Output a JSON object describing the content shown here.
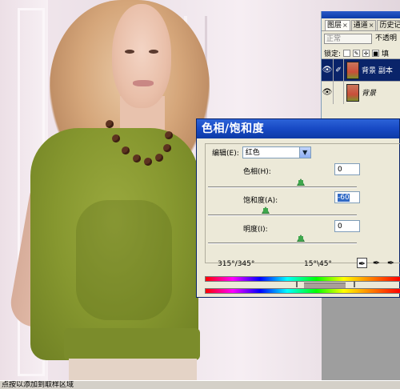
{
  "layers_panel": {
    "tabs": [
      {
        "label": "图层"
      },
      {
        "label": "通道"
      },
      {
        "label": "历史记录"
      }
    ],
    "blend_mode": "正常",
    "opacity_label": "不透明",
    "lock_label": "锁定:",
    "fill_label": "填",
    "layers": [
      {
        "name": "背景 副本",
        "selected": true
      },
      {
        "name": "背景",
        "selected": false
      }
    ]
  },
  "dialog": {
    "title": "色相/饱和度",
    "edit_label": "编辑(E):",
    "edit_value": "红色",
    "hue_label": "色相(H):",
    "hue_value": "0",
    "saturation_label": "饱和度(A):",
    "saturation_value": "-60",
    "lightness_label": "明度(I):",
    "lightness_value": "0",
    "range_left": "315°/345°",
    "range_right": "15°\\45°"
  },
  "status_bar": {
    "text": "点按以添加到取样区域"
  },
  "colors": {
    "titlebar": "#1749c4",
    "panel_bg": "#ece9d8",
    "selected_layer": "#0a246a"
  }
}
